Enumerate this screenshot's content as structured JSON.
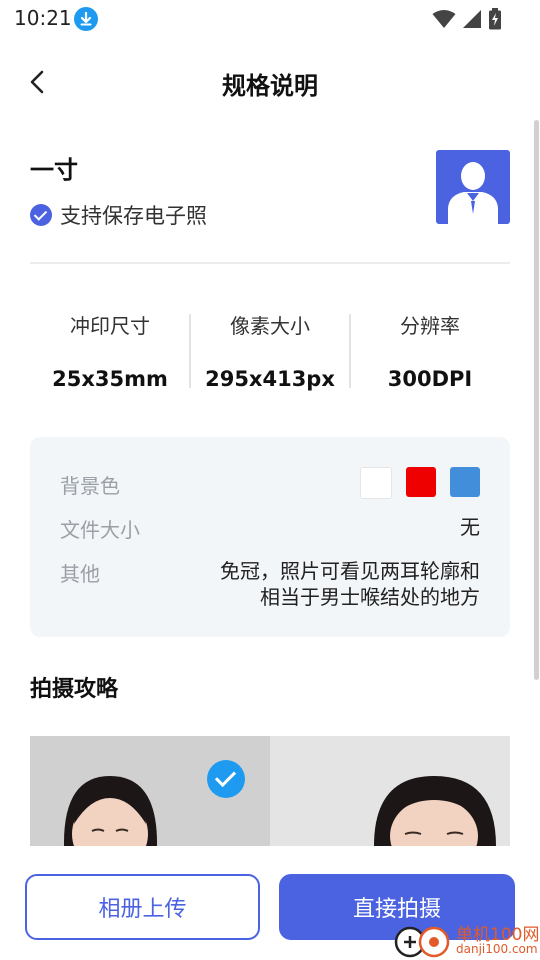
{
  "status_bar": {
    "time": "10:21"
  },
  "header": {
    "title": "规格说明"
  },
  "size": {
    "name": "一寸",
    "support_text": "支持保存电子照"
  },
  "specs": [
    {
      "label": "冲印尺寸",
      "value": "25x35mm"
    },
    {
      "label": "像素大小",
      "value": "295x413px"
    },
    {
      "label": "分辨率",
      "value": "300DPI"
    }
  ],
  "info": {
    "background_label": "背景色",
    "background_colors": [
      "#ffffff",
      "#ee0000",
      "#438edb"
    ],
    "file_size_label": "文件大小",
    "file_size_value": "无",
    "other_label": "其他",
    "other_value_line1": "免冠，照片可看见两耳轮廓和",
    "other_value_line2": "相当于男士喉结处的地方"
  },
  "tips": {
    "title": "拍摄攻略"
  },
  "buttons": {
    "upload": "相册上传",
    "shoot": "直接拍摄"
  },
  "watermark": {
    "text": "单机100网",
    "url": "danji100.com"
  },
  "colors": {
    "accent": "#4b63e0",
    "check_blue": "#1e9bf0"
  }
}
